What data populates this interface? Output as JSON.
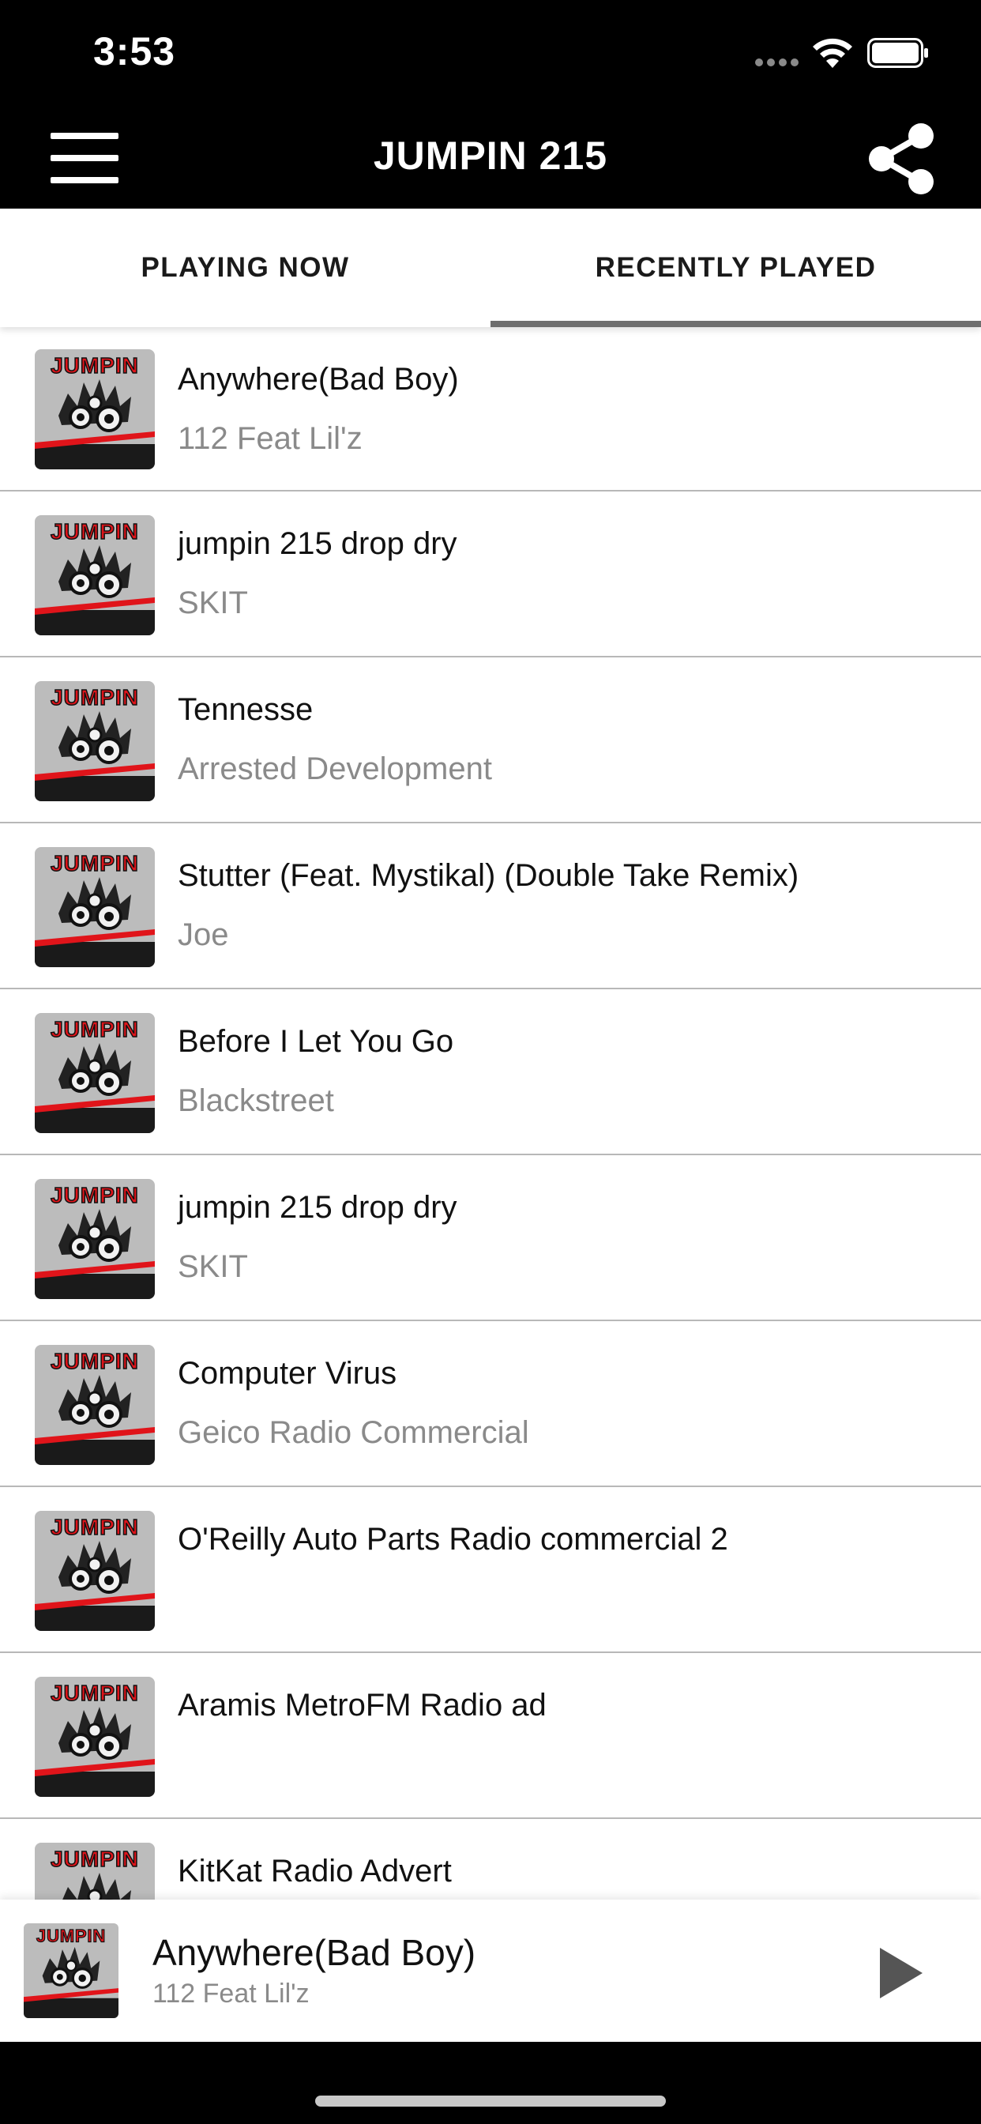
{
  "status_bar": {
    "time": "3:53",
    "icons": [
      "cellular-signal-icon",
      "wifi-icon",
      "battery-icon"
    ]
  },
  "app_bar": {
    "title": "JUMPIN 215",
    "left_icon": "hamburger-menu-icon",
    "right_icon": "share-icon"
  },
  "tabs": {
    "items": [
      {
        "label": "PLAYING NOW",
        "selected": false
      },
      {
        "label": "RECENTLY PLAYED",
        "selected": true
      }
    ],
    "indicator_color": "#6e6e6e"
  },
  "recently_played": [
    {
      "title": "Anywhere(Bad Boy)",
      "artist": "112 Feat Lil'z"
    },
    {
      "title": "jumpin 215 drop dry",
      "artist": "SKIT"
    },
    {
      "title": "Tennesse",
      "artist": "Arrested Development"
    },
    {
      "title": "Stutter (Feat. Mystikal) (Double Take Remix)",
      "artist": "Joe"
    },
    {
      "title": "Before I Let You Go",
      "artist": "Blackstreet"
    },
    {
      "title": "jumpin 215 drop dry",
      "artist": "SKIT"
    },
    {
      "title": "Computer Virus",
      "artist": "Geico Radio Commercial"
    },
    {
      "title": "O'Reilly Auto Parts Radio commercial 2",
      "artist": ""
    },
    {
      "title": "Aramis MetroFM Radio ad",
      "artist": ""
    },
    {
      "title": "KitKat Radio Advert",
      "artist": ""
    }
  ],
  "album_art": {
    "logo_text": "JUMPIN"
  },
  "mini_player": {
    "title": "Anywhere(Bad Boy)",
    "artist": "112 Feat Lil'z",
    "action_icon": "play-icon"
  },
  "colors": {
    "bars": "#000000",
    "row_divider": "#b8b8b8",
    "artist_text": "#8a8a8a",
    "art_accent_red": "#e0141a"
  }
}
